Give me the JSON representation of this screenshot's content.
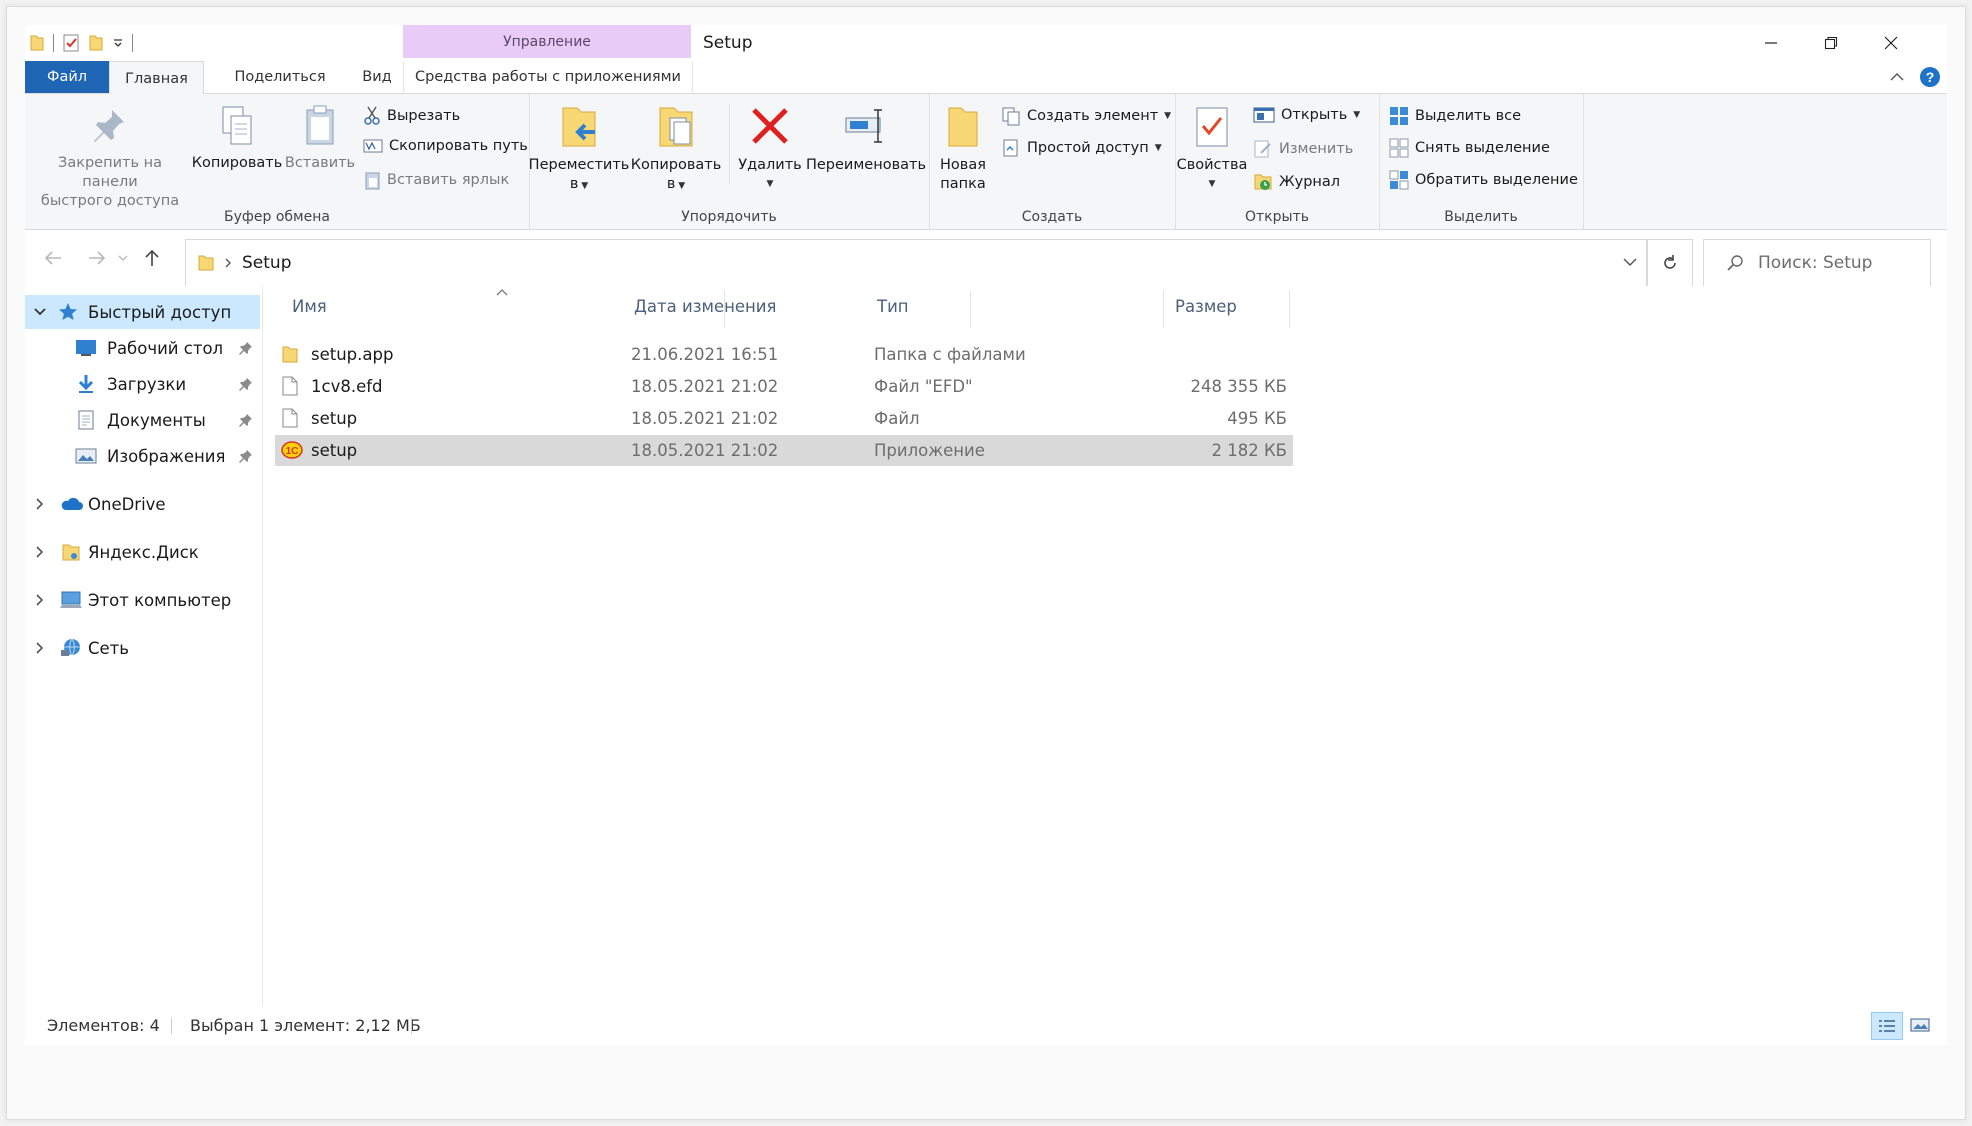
{
  "window": {
    "title": "Setup",
    "context_header": "Управление"
  },
  "tabs": {
    "file": "Файл",
    "home": "Главная",
    "share": "Поделиться",
    "view": "Вид",
    "app_tools": "Средства работы с приложениями"
  },
  "ribbon": {
    "clipboard": {
      "group_label": "Буфер обмена",
      "pin_line1": "Закрепить на панели",
      "pin_line2": "быстрого доступа",
      "copy": "Копировать",
      "paste": "Вставить",
      "cut": "Вырезать",
      "copy_path": "Скопировать путь",
      "paste_shortcut": "Вставить ярлык"
    },
    "organize": {
      "group_label": "Упорядочить",
      "move_line1": "Переместить",
      "move_line2": "в",
      "copy_line1": "Копировать",
      "copy_line2": "в",
      "delete": "Удалить",
      "rename": "Переименовать"
    },
    "new": {
      "group_label": "Создать",
      "new_folder_line1": "Новая",
      "new_folder_line2": "папка",
      "new_item": "Создать элемент",
      "easy_access": "Простой доступ"
    },
    "open": {
      "group_label": "Открыть",
      "properties": "Свойства",
      "open": "Открыть",
      "edit": "Изменить",
      "history": "Журнал"
    },
    "select": {
      "group_label": "Выделить",
      "select_all": "Выделить все",
      "select_none": "Снять выделение",
      "invert": "Обратить выделение"
    }
  },
  "address": {
    "path": "Setup",
    "search_placeholder": "Поиск: Setup"
  },
  "nav": {
    "quick_access": "Быстрый доступ",
    "desktop": "Рабочий стол",
    "downloads": "Загрузки",
    "documents": "Документы",
    "pictures": "Изображения",
    "onedrive": "OneDrive",
    "yandex": "Яндекс.Диск",
    "this_pc": "Этот компьютер",
    "network": "Сеть"
  },
  "columns": {
    "name": "Имя",
    "date": "Дата изменения",
    "type": "Тип",
    "size": "Размер"
  },
  "files": [
    {
      "name": "setup.app",
      "date": "21.06.2021 16:51",
      "type": "Папка с файлами",
      "size": "",
      "icon": "folder-icon"
    },
    {
      "name": "1cv8.efd",
      "date": "18.05.2021 21:02",
      "type": "Файл \"EFD\"",
      "size": "248 355 КБ",
      "icon": "file-icon"
    },
    {
      "name": "setup",
      "date": "18.05.2021 21:02",
      "type": "Файл",
      "size": "495 КБ",
      "icon": "file-icon"
    },
    {
      "name": "setup",
      "date": "18.05.2021 21:02",
      "type": "Приложение",
      "size": "2 182 КБ",
      "icon": "app-1c-icon",
      "selected": true
    }
  ],
  "status": {
    "count": "Элементов: 4",
    "selection": "Выбран 1 элемент: 2,12 МБ"
  },
  "colors": {
    "accent": "#1e65b4",
    "context_tab": "#e9cbf8",
    "nav_selected": "#cce8ff",
    "row_selected": "#d9d9d9",
    "folder": "#f8d775"
  }
}
